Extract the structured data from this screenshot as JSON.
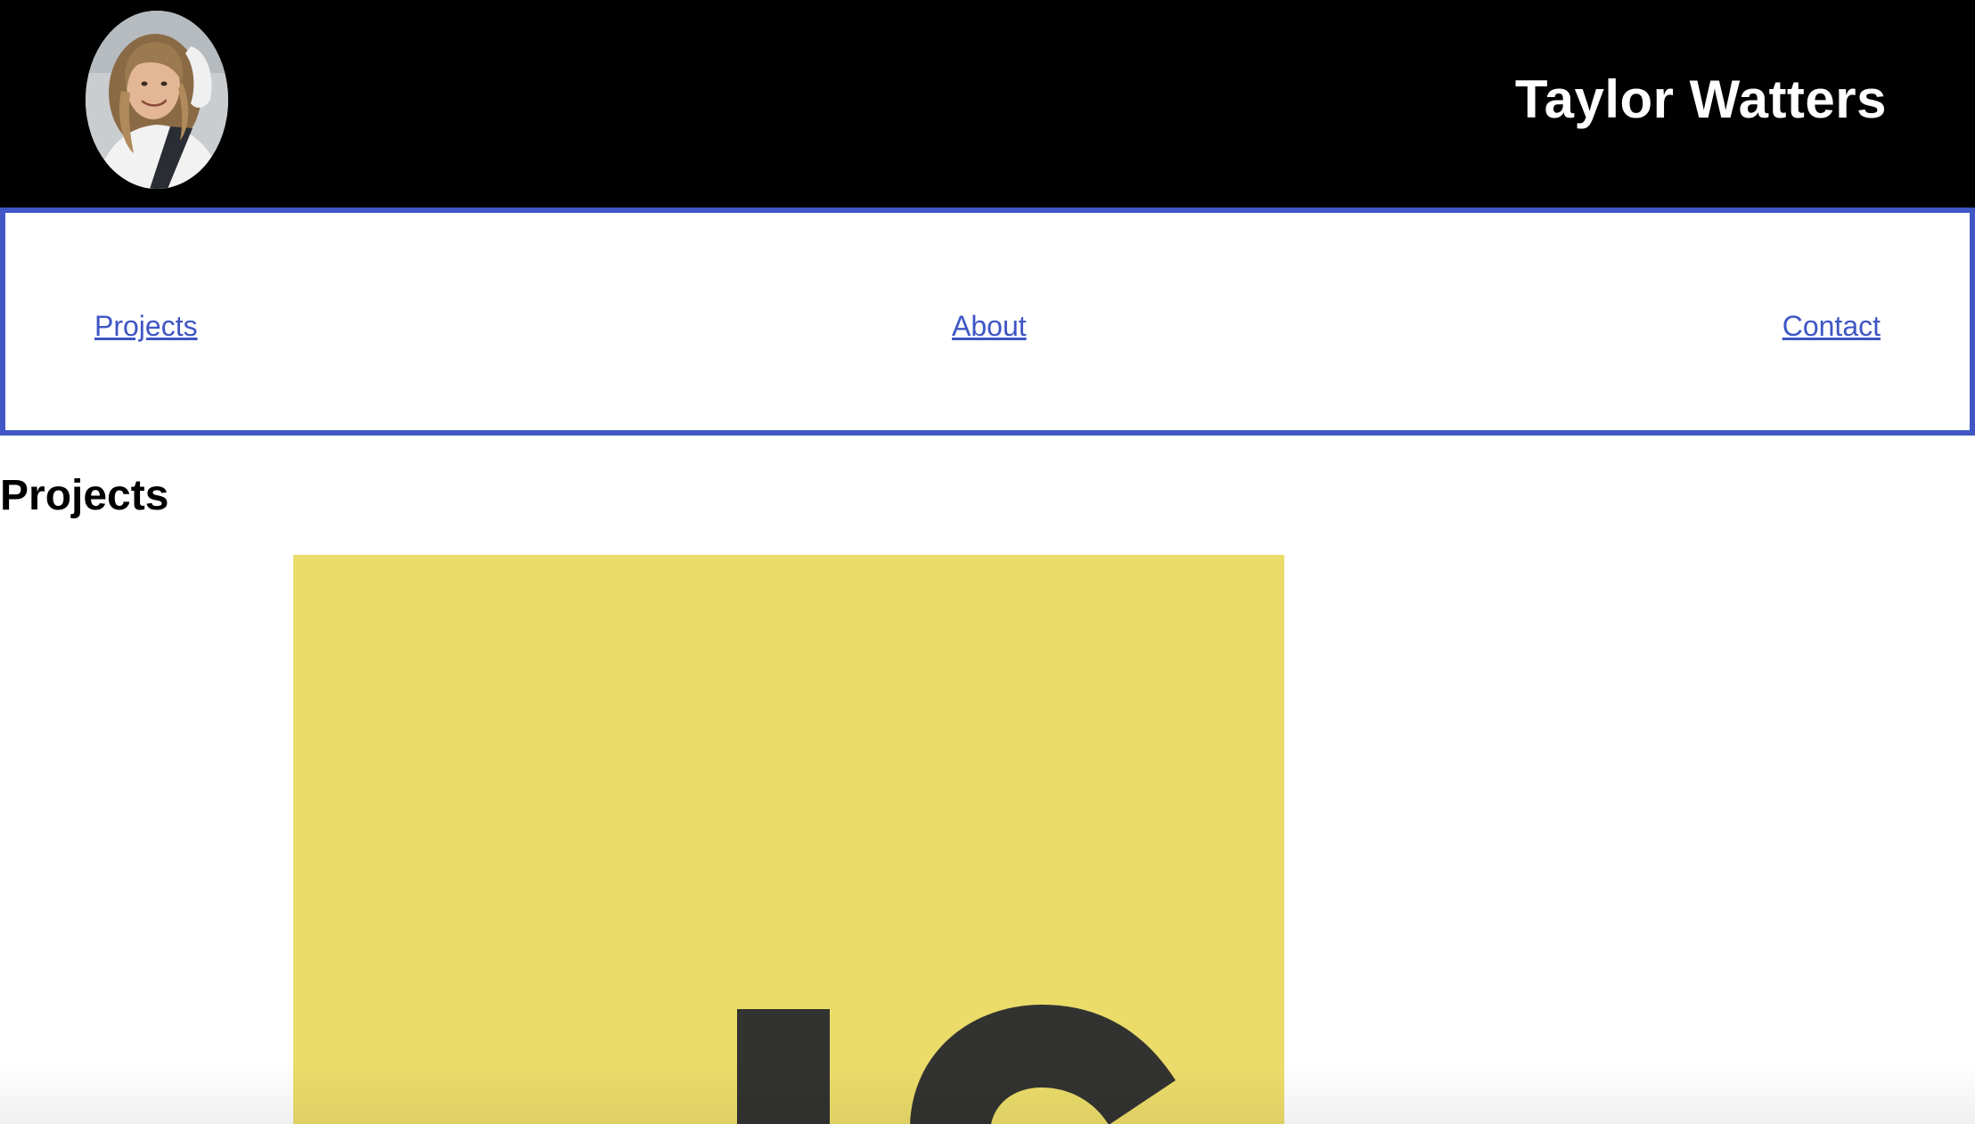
{
  "header": {
    "title": "Taylor Watters",
    "avatar_icon": "profile-photo",
    "background_color": "#000000",
    "title_color": "#ffffff"
  },
  "nav": {
    "border_color": "#3f56c4",
    "link_color": "#3f56c4",
    "items": [
      {
        "label": "Projects"
      },
      {
        "label": "About"
      },
      {
        "label": "Contact"
      }
    ]
  },
  "main": {
    "section_title": "Projects",
    "project_image": {
      "icon": "javascript-logo",
      "text": "JS",
      "background_color": "#ebdc6a",
      "text_color": "#323330"
    }
  }
}
